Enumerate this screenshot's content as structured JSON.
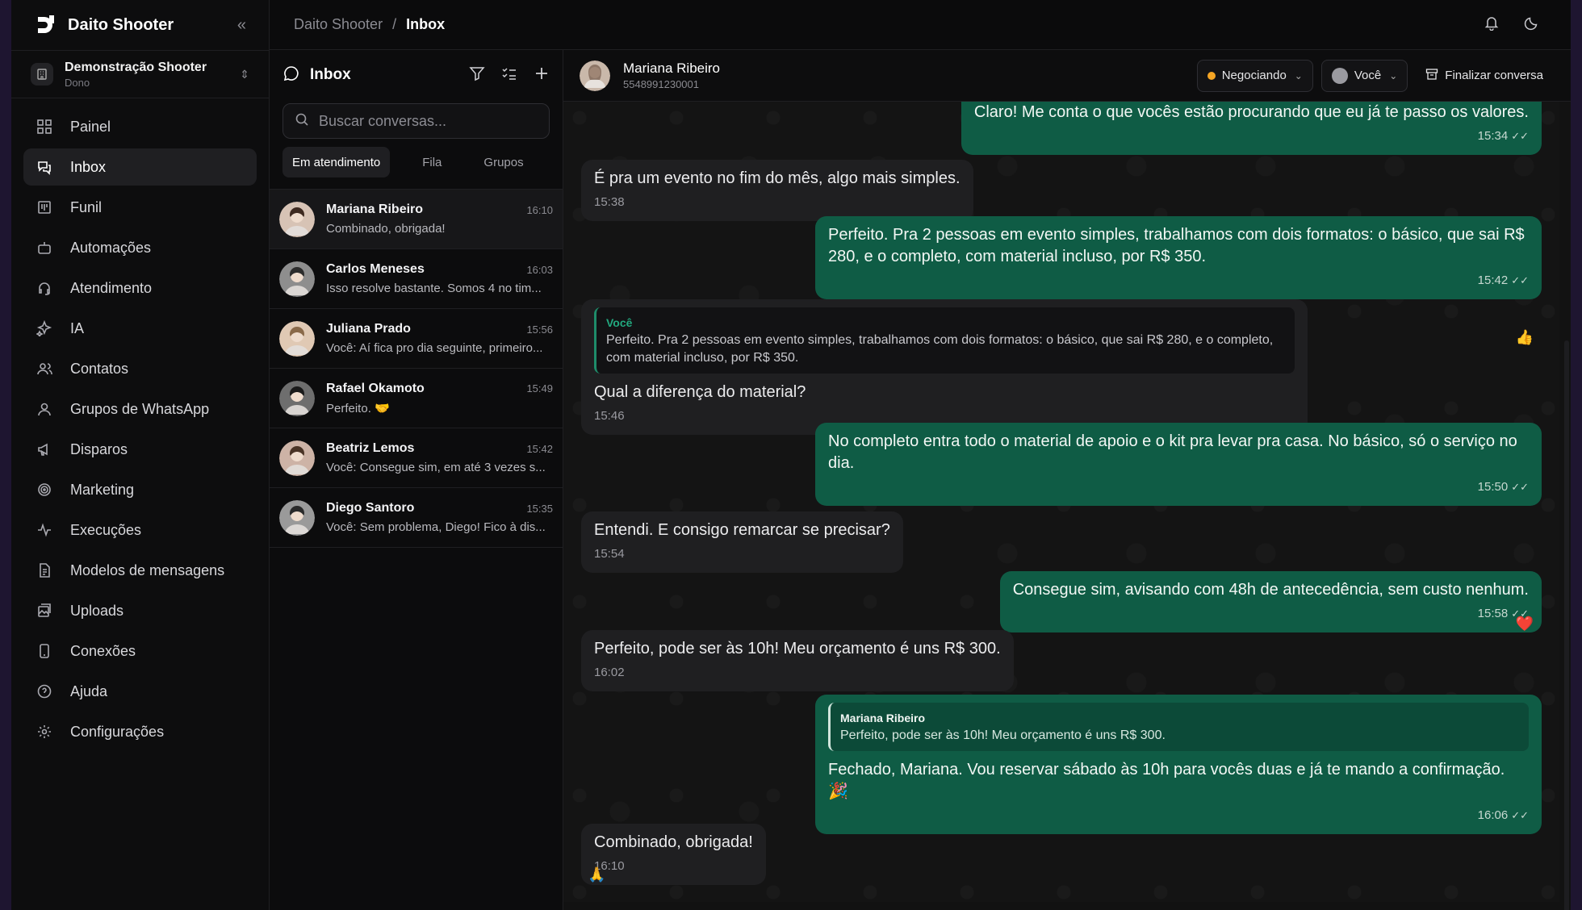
{
  "app": {
    "name": "Daito Shooter",
    "workspace_name": "Demonstração Shooter",
    "workspace_role": "Dono"
  },
  "breadcrumb": {
    "root": "Daito Shooter",
    "separator": "/",
    "current": "Inbox"
  },
  "sidebar": {
    "items": [
      {
        "label": "Painel",
        "icon": "grid-icon"
      },
      {
        "label": "Inbox",
        "icon": "chat-icon",
        "active": true
      },
      {
        "label": "Funil",
        "icon": "kanban-icon"
      },
      {
        "label": "Automações",
        "icon": "bot-icon"
      },
      {
        "label": "Atendimento",
        "icon": "headset-icon"
      },
      {
        "label": "IA",
        "icon": "sparkles-icon"
      },
      {
        "label": "Contatos",
        "icon": "users-icon"
      },
      {
        "label": "Grupos de WhatsApp",
        "icon": "group-icon"
      },
      {
        "label": "Disparos",
        "icon": "megaphone-icon"
      },
      {
        "label": "Marketing",
        "icon": "target-icon"
      },
      {
        "label": "Execuções",
        "icon": "activity-icon"
      },
      {
        "label": "Modelos de mensagens",
        "icon": "file-text-icon"
      },
      {
        "label": "Uploads",
        "icon": "image-upload-icon"
      },
      {
        "label": "Conexões",
        "icon": "phone-icon"
      },
      {
        "label": "Ajuda",
        "icon": "help-icon"
      },
      {
        "label": "Configurações",
        "icon": "settings-icon"
      }
    ]
  },
  "inbox": {
    "title": "Inbox",
    "search_placeholder": "Buscar conversas...",
    "tabs": [
      "Em atendimento",
      "Fila",
      "Grupos"
    ],
    "conversations": [
      {
        "name": "Mariana Ribeiro",
        "time": "16:10",
        "preview": "Combinado, obrigada!",
        "selected": true
      },
      {
        "name": "Carlos Meneses",
        "time": "16:03",
        "preview": "Isso resolve bastante. Somos 4 no tim..."
      },
      {
        "name": "Juliana Prado",
        "time": "15:56",
        "preview": "Você: Aí fica pro dia seguinte, primeiro..."
      },
      {
        "name": "Rafael Okamoto",
        "time": "15:49",
        "preview": "Perfeito. 🤝"
      },
      {
        "name": "Beatriz Lemos",
        "time": "15:42",
        "preview": "Você: Consegue sim, em até 3 vezes s..."
      },
      {
        "name": "Diego Santoro",
        "time": "15:35",
        "preview": "Você: Sem problema, Diego! Fico à dis..."
      }
    ]
  },
  "chat": {
    "contact_name": "Mariana Ribeiro",
    "contact_phone": "5548991230001",
    "status": "Negociando",
    "assignee": "Você",
    "finalize_label": "Finalizar conversa",
    "messages": [
      {
        "dir": "out",
        "text": "Claro! Me conta o que vocês estão procurando que eu já te passo os valores.",
        "time": "15:34"
      },
      {
        "dir": "in",
        "text": "É pra um evento no fim do mês, algo mais simples.",
        "time": "15:38"
      },
      {
        "dir": "out",
        "text": "Perfeito. Pra 2 pessoas em evento simples, trabalhamos com dois formatos: o básico, que sai R$ 280, e o completo, com material incluso, por R$ 350.",
        "time": "15:42",
        "reaction": "👍"
      },
      {
        "dir": "in",
        "quote_name": "Você",
        "quote_text": "Perfeito. Pra 2 pessoas em evento simples, trabalhamos com dois formatos: o básico, que sai R$ 280, e o completo, com material incluso, por R$ 350.",
        "text": "Qual a diferença do material?",
        "time": "15:46"
      },
      {
        "dir": "out",
        "text": "No completo entra todo o material de apoio e o kit pra levar pra casa. No básico, só o serviço no dia.",
        "time": "15:50"
      },
      {
        "dir": "in",
        "text": "Entendi. E consigo remarcar se precisar?",
        "time": "15:54"
      },
      {
        "dir": "out",
        "text": "Consegue sim, avisando com 48h de antecedência, sem custo nenhum.",
        "time": "15:58",
        "reaction": "❤️"
      },
      {
        "dir": "in",
        "text": "Perfeito, pode ser às 10h! Meu orçamento é uns R$ 300.",
        "time": "16:02"
      },
      {
        "dir": "out",
        "quote_name": "Mariana Ribeiro",
        "quote_text": "Perfeito, pode ser às 10h! Meu orçamento é uns R$ 300.",
        "text": "Fechado, Mariana. Vou reservar sábado às 10h para vocês duas e já te mando a confirmação. 🎉",
        "time": "16:06"
      },
      {
        "dir": "in",
        "text": "Combinado, obrigada!",
        "time": "16:10",
        "reaction": "🙏"
      }
    ]
  }
}
